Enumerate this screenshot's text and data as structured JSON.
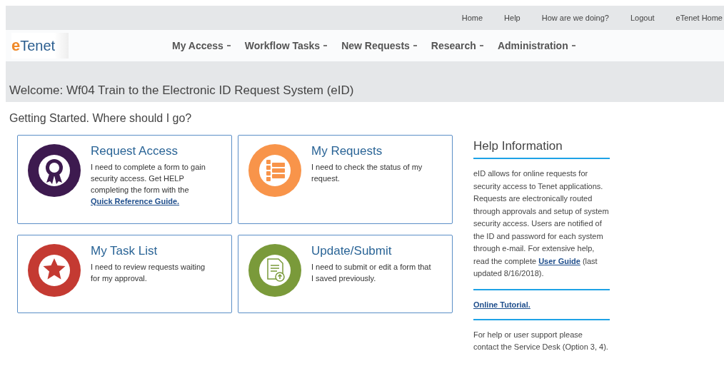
{
  "top_links": [
    "Home",
    "Help",
    "How are we doing?",
    "Logout",
    "eTenet Home"
  ],
  "logo": {
    "mark": "e",
    "name": "Tenet"
  },
  "nav": [
    {
      "label": "My Access",
      "dropdown": true
    },
    {
      "label": "Workflow Tasks",
      "dropdown": true
    },
    {
      "label": "New Requests",
      "dropdown": true
    },
    {
      "label": "Research",
      "dropdown": true
    },
    {
      "label": "Administration",
      "dropdown": true
    }
  ],
  "welcome": "Welcome: Wf04 Train to the Electronic ID Request System (eID)",
  "subtitle": "Getting Started. Where should I go?",
  "cards": [
    {
      "title": "Request Access",
      "kind": "award",
      "color": "#3d1a4f",
      "description": "I need to complete a form to gain security access. Get HELP completing the form with the",
      "link": "Quick Reference Guide."
    },
    {
      "title": "My Requests",
      "kind": "list",
      "color": "#f8944a",
      "description": "I need to check the status of my request."
    },
    {
      "title": "My Task List",
      "kind": "star",
      "color": "#c43a32",
      "description": "I need to review requests waiting for my approval."
    },
    {
      "title": "Update/Submit",
      "kind": "document",
      "color": "#7a9a3a",
      "description": "I need to submit or edit a form that I saved previously."
    }
  ],
  "help": {
    "title": "Help Information",
    "text_before": "eID allows for online requests for security access to Tenet applications. Requests are electronically routed through approvals and setup of system security access. Users are notified of the ID and password for each system through e-mail. For extensive help, read the complete",
    "link": "User Guide",
    "text_after": "(last updated 8/16/2018).",
    "tutorial": "Online Tutorial.",
    "support": "For help or user support please contact the Service Desk (Option 3, 4)."
  }
}
